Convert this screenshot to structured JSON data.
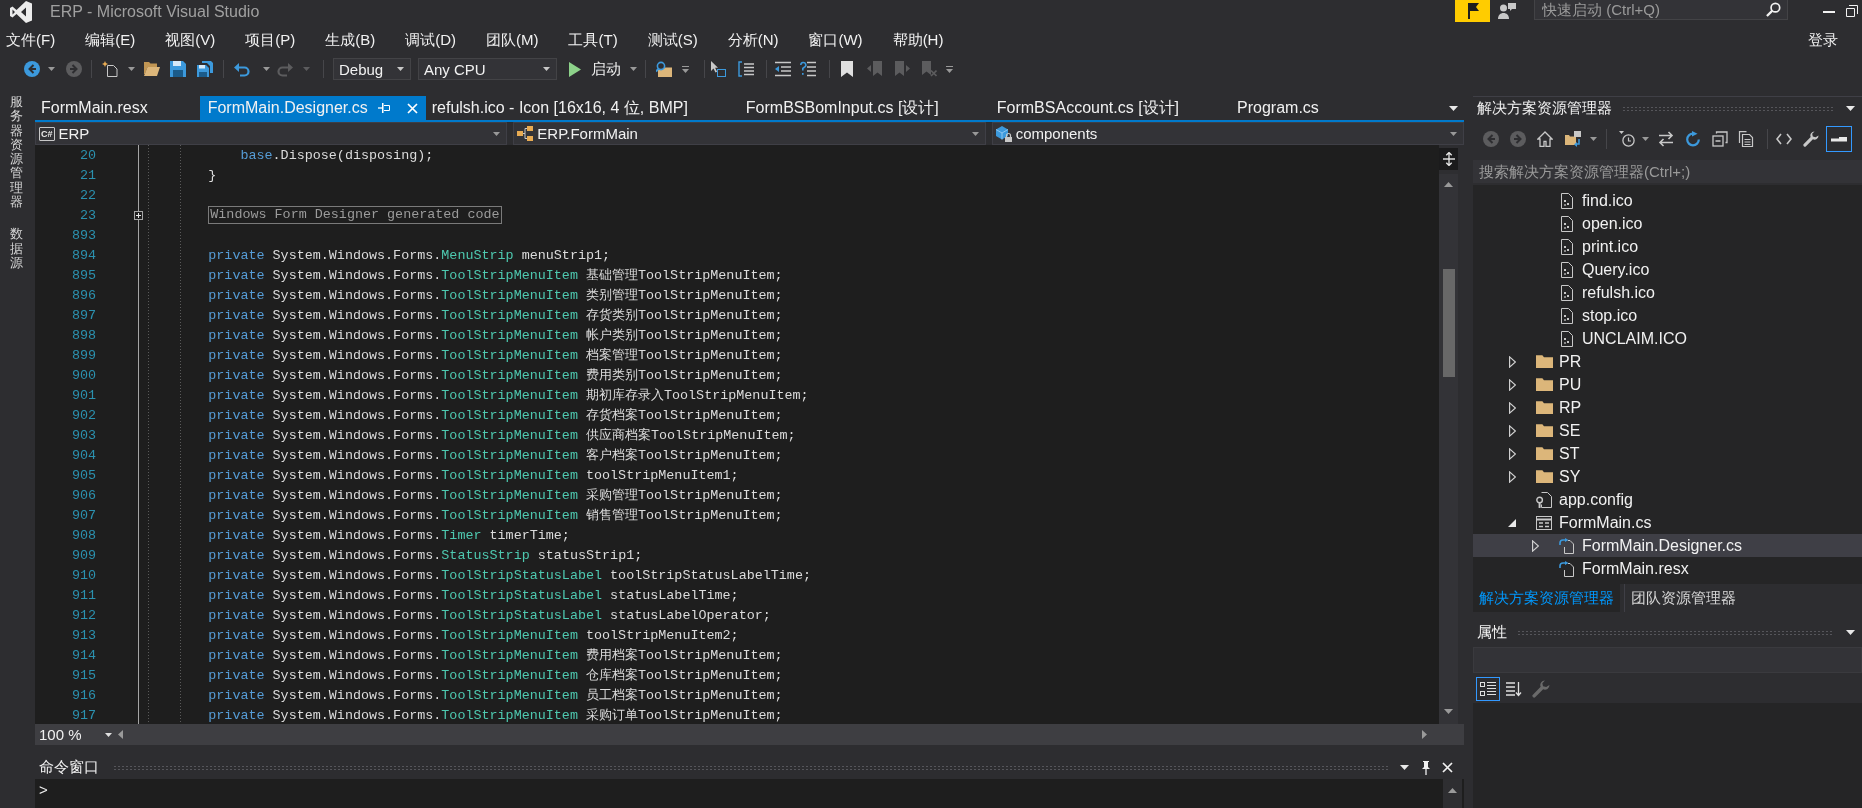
{
  "title_bar": {
    "title": "ERP - Microsoft Visual Studio",
    "quick_launch": {
      "placeholder": "快速启动 (Ctrl+Q)"
    }
  },
  "menu_bar": {
    "items": [
      "文件(F)",
      "编辑(E)",
      "视图(V)",
      "项目(P)",
      "生成(B)",
      "调试(D)",
      "团队(M)",
      "工具(T)",
      "测试(S)",
      "分析(N)",
      "窗口(W)",
      "帮助(H)"
    ],
    "sign_in": "登录"
  },
  "toolbar": {
    "navigation": [
      {
        "disabled": false
      },
      {
        "disabled": true
      }
    ],
    "history": [
      {
        "disabled": false
      },
      {
        "disabled": true
      }
    ],
    "configuration": "Debug",
    "platform": "Any CPU",
    "start": "启动",
    "bookmarks": [
      {
        "disabled": false
      },
      {
        "disabled": true
      },
      {
        "disabled": true
      },
      {
        "disabled": true
      }
    ]
  },
  "side_tabs": [
    "服务器资源管理器",
    "数据源"
  ],
  "document_tabs": [
    {
      "label": "FormMain.resx",
      "selected": false
    },
    {
      "label": "FormMain.Designer.cs",
      "selected": true
    },
    {
      "label": "refulsh.ico - Icon [16x16, 4 位, BMP]",
      "selected": false
    },
    {
      "label": "FormBSBomInput.cs [设计]",
      "selected": false
    },
    {
      "label": "FormBSAccount.cs [设计]",
      "selected": false
    },
    {
      "label": "Program.cs",
      "selected": false
    }
  ],
  "navigation_bar": {
    "project": {
      "badge": "C#",
      "label": "ERP"
    },
    "type": "ERP.FormMain",
    "member": "components"
  },
  "editor": {
    "continued_block": [
      {
        "number": "20",
        "tokens": [
          {
            "kind": "keyword",
            "text": "base"
          },
          {
            "kind": "plain",
            "text": ".Dispose(disposing);"
          }
        ]
      }
    ],
    "lines": [
      {
        "number": "21",
        "tokens": [
          {
            "kind": "plain",
            "text": "}"
          }
        ]
      },
      {
        "number": "22"
      },
      {
        "number": "23",
        "expanded": false,
        "tokens": [
          {
            "kind": "region",
            "text": "Windows Form Designer generated code"
          }
        ]
      },
      {
        "number": "893"
      },
      {
        "number": "894",
        "tokens": [
          {
            "kind": "keyword",
            "text": "private"
          },
          {
            "kind": "plain",
            "text": " System.Windows.Forms."
          },
          {
            "kind": "type",
            "text": "MenuStrip"
          },
          {
            "kind": "plain",
            "text": " menuStrip1;"
          }
        ]
      },
      {
        "number": "895",
        "tokens": [
          {
            "kind": "keyword",
            "text": "private"
          },
          {
            "kind": "plain",
            "text": " System.Windows.Forms."
          },
          {
            "kind": "type",
            "text": "ToolStripMenuItem"
          },
          {
            "kind": "plain",
            "text": " 基础管理ToolStripMenuItem;"
          }
        ]
      },
      {
        "number": "896",
        "tokens": [
          {
            "kind": "keyword",
            "text": "private"
          },
          {
            "kind": "plain",
            "text": " System.Windows.Forms."
          },
          {
            "kind": "type",
            "text": "ToolStripMenuItem"
          },
          {
            "kind": "plain",
            "text": " 类别管理ToolStripMenuItem;"
          }
        ]
      },
      {
        "number": "897",
        "tokens": [
          {
            "kind": "keyword",
            "text": "private"
          },
          {
            "kind": "plain",
            "text": " System.Windows.Forms."
          },
          {
            "kind": "type",
            "text": "ToolStripMenuItem"
          },
          {
            "kind": "plain",
            "text": " 存货类别ToolStripMenuItem;"
          }
        ]
      },
      {
        "number": "898",
        "tokens": [
          {
            "kind": "keyword",
            "text": "private"
          },
          {
            "kind": "plain",
            "text": " System.Windows.Forms."
          },
          {
            "kind": "type",
            "text": "ToolStripMenuItem"
          },
          {
            "kind": "plain",
            "text": " 帐户类别ToolStripMenuItem;"
          }
        ]
      },
      {
        "number": "899",
        "tokens": [
          {
            "kind": "keyword",
            "text": "private"
          },
          {
            "kind": "plain",
            "text": " System.Windows.Forms."
          },
          {
            "kind": "type",
            "text": "ToolStripMenuItem"
          },
          {
            "kind": "plain",
            "text": " 档案管理ToolStripMenuItem;"
          }
        ]
      },
      {
        "number": "900",
        "tokens": [
          {
            "kind": "keyword",
            "text": "private"
          },
          {
            "kind": "plain",
            "text": " System.Windows.Forms."
          },
          {
            "kind": "type",
            "text": "ToolStripMenuItem"
          },
          {
            "kind": "plain",
            "text": " 费用类别ToolStripMenuItem;"
          }
        ]
      },
      {
        "number": "901",
        "tokens": [
          {
            "kind": "keyword",
            "text": "private"
          },
          {
            "kind": "plain",
            "text": " System.Windows.Forms."
          },
          {
            "kind": "type",
            "text": "ToolStripMenuItem"
          },
          {
            "kind": "plain",
            "text": " 期初库存录入ToolStripMenuItem;"
          }
        ]
      },
      {
        "number": "902",
        "tokens": [
          {
            "kind": "keyword",
            "text": "private"
          },
          {
            "kind": "plain",
            "text": " System.Windows.Forms."
          },
          {
            "kind": "type",
            "text": "ToolStripMenuItem"
          },
          {
            "kind": "plain",
            "text": " 存货档案ToolStripMenuItem;"
          }
        ]
      },
      {
        "number": "903",
        "tokens": [
          {
            "kind": "keyword",
            "text": "private"
          },
          {
            "kind": "plain",
            "text": " System.Windows.Forms."
          },
          {
            "kind": "type",
            "text": "ToolStripMenuItem"
          },
          {
            "kind": "plain",
            "text": " 供应商档案ToolStripMenuItem;"
          }
        ]
      },
      {
        "number": "904",
        "tokens": [
          {
            "kind": "keyword",
            "text": "private"
          },
          {
            "kind": "plain",
            "text": " System.Windows.Forms."
          },
          {
            "kind": "type",
            "text": "ToolStripMenuItem"
          },
          {
            "kind": "plain",
            "text": " 客户档案ToolStripMenuItem;"
          }
        ]
      },
      {
        "number": "905",
        "tokens": [
          {
            "kind": "keyword",
            "text": "private"
          },
          {
            "kind": "plain",
            "text": " System.Windows.Forms."
          },
          {
            "kind": "type",
            "text": "ToolStripMenuItem"
          },
          {
            "kind": "plain",
            "text": " toolStripMenuItem1;"
          }
        ]
      },
      {
        "number": "906",
        "tokens": [
          {
            "kind": "keyword",
            "text": "private"
          },
          {
            "kind": "plain",
            "text": " System.Windows.Forms."
          },
          {
            "kind": "type",
            "text": "ToolStripMenuItem"
          },
          {
            "kind": "plain",
            "text": " 采购管理ToolStripMenuItem;"
          }
        ]
      },
      {
        "number": "907",
        "tokens": [
          {
            "kind": "keyword",
            "text": "private"
          },
          {
            "kind": "plain",
            "text": " System.Windows.Forms."
          },
          {
            "kind": "type",
            "text": "ToolStripMenuItem"
          },
          {
            "kind": "plain",
            "text": " 销售管理ToolStripMenuItem;"
          }
        ]
      },
      {
        "number": "908",
        "tokens": [
          {
            "kind": "keyword",
            "text": "private"
          },
          {
            "kind": "plain",
            "text": " System.Windows.Forms."
          },
          {
            "kind": "type",
            "text": "Timer"
          },
          {
            "kind": "plain",
            "text": " timerTime;"
          }
        ]
      },
      {
        "number": "909",
        "tokens": [
          {
            "kind": "keyword",
            "text": "private"
          },
          {
            "kind": "plain",
            "text": " System.Windows.Forms."
          },
          {
            "kind": "type",
            "text": "StatusStrip"
          },
          {
            "kind": "plain",
            "text": " statusStrip1;"
          }
        ]
      },
      {
        "number": "910",
        "tokens": [
          {
            "kind": "keyword",
            "text": "private"
          },
          {
            "kind": "plain",
            "text": " System.Windows.Forms."
          },
          {
            "kind": "type",
            "text": "ToolStripStatusLabel"
          },
          {
            "kind": "plain",
            "text": " toolStripStatusLabelTime;"
          }
        ]
      },
      {
        "number": "911",
        "tokens": [
          {
            "kind": "keyword",
            "text": "private"
          },
          {
            "kind": "plain",
            "text": " System.Windows.Forms."
          },
          {
            "kind": "type",
            "text": "ToolStripStatusLabel"
          },
          {
            "kind": "plain",
            "text": " statusLabelTime;"
          }
        ]
      },
      {
        "number": "912",
        "tokens": [
          {
            "kind": "keyword",
            "text": "private"
          },
          {
            "kind": "plain",
            "text": " System.Windows.Forms."
          },
          {
            "kind": "type",
            "text": "ToolStripStatusLabel"
          },
          {
            "kind": "plain",
            "text": " statusLabelOperator;"
          }
        ]
      },
      {
        "number": "913",
        "tokens": [
          {
            "kind": "keyword",
            "text": "private"
          },
          {
            "kind": "plain",
            "text": " System.Windows.Forms."
          },
          {
            "kind": "type",
            "text": "ToolStripMenuItem"
          },
          {
            "kind": "plain",
            "text": " toolStripMenuItem2;"
          }
        ]
      },
      {
        "number": "914",
        "tokens": [
          {
            "kind": "keyword",
            "text": "private"
          },
          {
            "kind": "plain",
            "text": " System.Windows.Forms."
          },
          {
            "kind": "type",
            "text": "ToolStripMenuItem"
          },
          {
            "kind": "plain",
            "text": " 费用档案ToolStripMenuItem;"
          }
        ]
      },
      {
        "number": "915",
        "tokens": [
          {
            "kind": "keyword",
            "text": "private"
          },
          {
            "kind": "plain",
            "text": " System.Windows.Forms."
          },
          {
            "kind": "type",
            "text": "ToolStripMenuItem"
          },
          {
            "kind": "plain",
            "text": " 仓库档案ToolStripMenuItem;"
          }
        ]
      },
      {
        "number": "916",
        "tokens": [
          {
            "kind": "keyword",
            "text": "private"
          },
          {
            "kind": "plain",
            "text": " System.Windows.Forms."
          },
          {
            "kind": "type",
            "text": "ToolStripMenuItem"
          },
          {
            "kind": "plain",
            "text": " 员工档案ToolStripMenuItem;"
          }
        ]
      },
      {
        "number": "917",
        "tokens": [
          {
            "kind": "keyword",
            "text": "private"
          },
          {
            "kind": "plain",
            "text": " System.Windows.Forms."
          },
          {
            "kind": "type",
            "text": "ToolStripMenuItem"
          },
          {
            "kind": "plain",
            "text": " 采购订单ToolStripMenuItem;"
          }
        ]
      }
    ],
    "zoom": "100 %"
  },
  "command_window": {
    "title": "命令窗口",
    "prompt": ">"
  },
  "solution_explorer": {
    "title": "解决方案资源管理器",
    "toolbar": {
      "navigation": [
        {
          "disabled": true
        },
        {
          "disabled": true
        }
      ],
      "preview": {
        "on": true
      }
    },
    "search": {
      "placeholder": "搜索解决方案资源管理器(Ctrl+;)"
    },
    "tree": {
      "continued_children": [
        {
          "label": "find.ico",
          "kind": "ico",
          "selected": false
        },
        {
          "label": "open.ico",
          "kind": "ico",
          "selected": false
        },
        {
          "label": "print.ico",
          "kind": "ico",
          "selected": false
        },
        {
          "label": "Query.ico",
          "kind": "ico",
          "selected": false
        },
        {
          "label": "refulsh.ico",
          "kind": "ico",
          "selected": false
        },
        {
          "label": "stop.ico",
          "kind": "ico",
          "selected": false
        },
        {
          "label": "UNCLAIM.ICO",
          "kind": "ico",
          "selected": false
        }
      ],
      "items": [
        {
          "label": "PR",
          "kind": "folder",
          "expanded": false,
          "selected": false
        },
        {
          "label": "PU",
          "kind": "folder",
          "expanded": false,
          "selected": false
        },
        {
          "label": "RP",
          "kind": "folder",
          "expanded": false,
          "selected": false
        },
        {
          "label": "SE",
          "kind": "folder",
          "expanded": false,
          "selected": false
        },
        {
          "label": "ST",
          "kind": "folder",
          "expanded": false,
          "selected": false
        },
        {
          "label": "SY",
          "kind": "folder",
          "expanded": false,
          "selected": false
        },
        {
          "label": "app.config",
          "kind": "config",
          "selected": false
        },
        {
          "label": "FormMain.cs",
          "kind": "form",
          "expanded": true,
          "selected": false,
          "children": [
            {
              "label": "FormMain.Designer.cs",
              "kind": "dependent",
              "expanded": false,
              "selected": true
            },
            {
              "label": "FormMain.resx",
              "kind": "dependent",
              "selected": false
            }
          ]
        }
      ]
    },
    "tabs": [
      {
        "label": "解决方案资源管理器",
        "selected": true
      },
      {
        "label": "团队资源管理器",
        "selected": false
      }
    ]
  },
  "properties": {
    "title": "属性",
    "view_buttons": [
      {
        "selected": true
      },
      {
        "selected": false
      }
    ],
    "property_pages": {
      "disabled": true
    }
  }
}
